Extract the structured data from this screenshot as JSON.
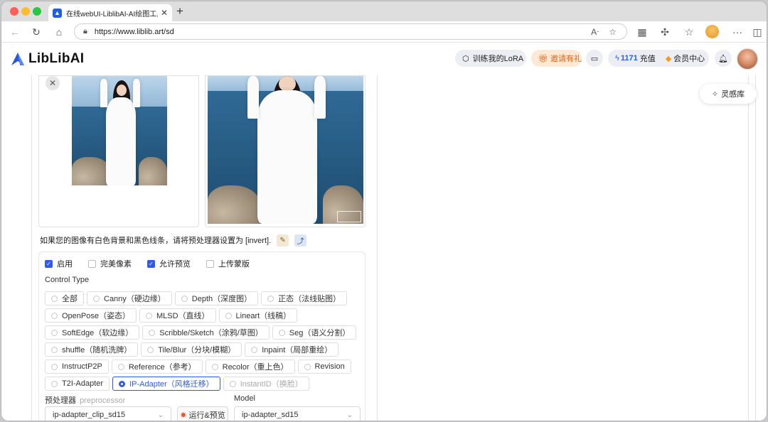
{
  "browser": {
    "tab_title": "在线webUI-LiblibAI-AI绘图工具",
    "tab_close": "✕",
    "new_tab": "+",
    "url": "https://www.liblib.art/sd"
  },
  "header": {
    "logo_text": "LibLibAI",
    "train_lora": "训练我的LoRA",
    "invite": "邀请有礼",
    "credits_count": "1171",
    "credits_label": "充值",
    "member_center": "会员中心"
  },
  "inspiration": "灵感库",
  "hint": "如果您的图像有白色背景和黑色线条，请将预处理器设置为 [invert].",
  "checks": [
    {
      "label": "启用",
      "checked": true
    },
    {
      "label": "完美像素",
      "checked": false
    },
    {
      "label": "允许预览",
      "checked": true
    },
    {
      "label": "上传蒙版",
      "checked": false
    }
  ],
  "control_type_label": "Control Type",
  "control_types": [
    [
      "全部",
      "Canny（硬边缘）",
      "Depth（深度图）",
      "正态（法线贴图）"
    ],
    [
      "OpenPose（姿态）",
      "MLSD（直线）",
      "Lineart（线稿）"
    ],
    [
      "SoftEdge（软边缘）",
      "Scribble/Sketch（涂鸦/草图）",
      "Seg（语义分割）"
    ],
    [
      "shuffle（随机洗牌）",
      "Tile/Blur（分块/模糊）",
      "Inpaint（局部重绘）"
    ],
    [
      "InstructP2P",
      "Reference（参考）",
      "Recolor（重上色）",
      "Revision"
    ],
    [
      "T2I-Adapter",
      "IP-Adapter（风格迁移）",
      "InstantID（换脸）"
    ]
  ],
  "selected_control_type": "IP-Adapter（风格迁移）",
  "disabled_control_type": "InstantID（换脸）",
  "preprocessor": {
    "label": "预处理器",
    "sublabel": "preprocessor",
    "value": "ip-adapter_clip_sd15"
  },
  "run_preview": "运行&预览",
  "model": {
    "label": "Model",
    "value": "ip-adapter_sd15"
  },
  "colors": {
    "accent": "#2f5bea",
    "invite": "#e0661a"
  }
}
